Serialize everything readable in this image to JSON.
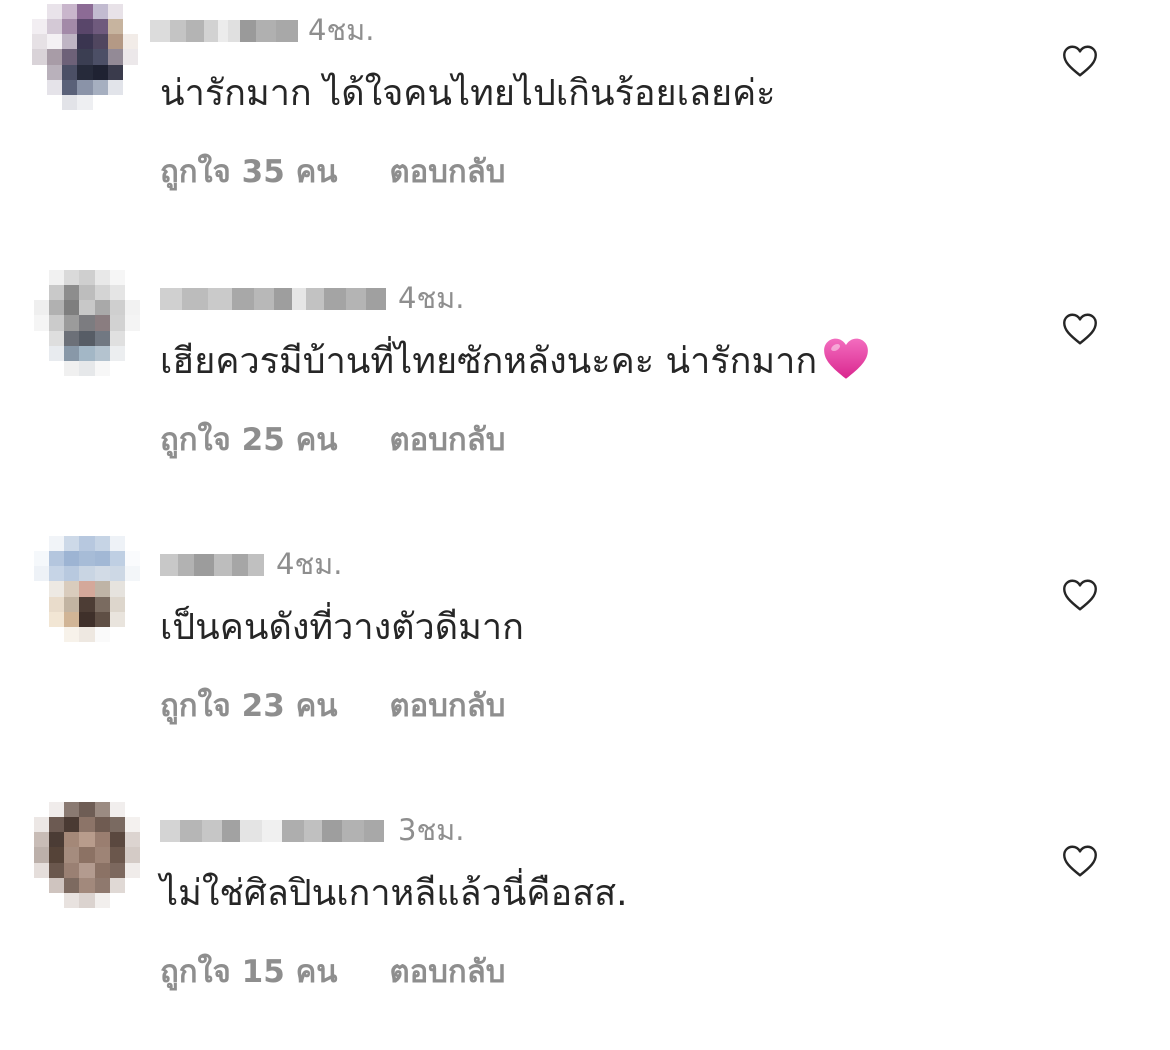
{
  "comments": [
    {
      "time": "4ชม.",
      "text": "น่ารักมาก ได้ใจคนไทยไปเกินร้อยเลยค่ะ",
      "likes": "ถูกใจ 35 คน",
      "reply": "ตอบกลับ",
      "has_emoji": false
    },
    {
      "time": "4ชม.",
      "text": "เฮียควรมีบ้านที่ไทยซักหลังนะคะ น่ารักมาก",
      "likes": "ถูกใจ 25 คน",
      "reply": "ตอบกลับ",
      "has_emoji": true
    },
    {
      "time": "4ชม.",
      "text": "เป็นคนดังที่วางตัวดีมาก",
      "likes": "ถูกใจ 23 คน",
      "reply": "ตอบกลับ",
      "has_emoji": false
    },
    {
      "time": "3ชม.",
      "text": "ไม่ใช่ศิลปินเกาหลีแล้วนี่คือสส.",
      "likes": "ถูกใจ 15 คน",
      "reply": "ตอบกลับ",
      "has_emoji": false
    }
  ],
  "icons": {
    "like": "heart-outline-icon",
    "emoji": "pink-heart-emoji"
  },
  "colors": {
    "text": "#262626",
    "secondary": "#8e8e8e",
    "emoji_pink": "#e83e9e"
  }
}
